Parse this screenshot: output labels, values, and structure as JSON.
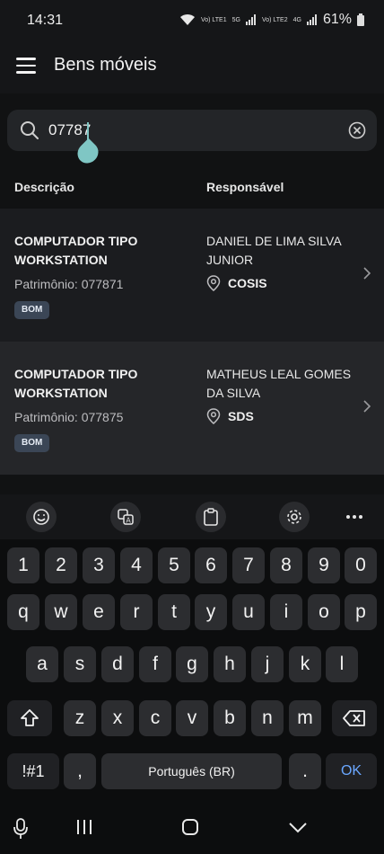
{
  "status": {
    "time": "14:31",
    "sim1": "Vo) LTE1",
    "sim2": "Vo) LTE2",
    "tag5g": "5G",
    "tag4g": "4G",
    "battery": "61%"
  },
  "app": {
    "title": "Bens móveis"
  },
  "search": {
    "value": "07787",
    "placeholder": ""
  },
  "table": {
    "headers": {
      "description": "Descrição",
      "responsible": "Responsável"
    },
    "rows": [
      {
        "description": "COMPUTADOR TIPO WORKSTATION",
        "patrimonio": "Patrimônio: 077871",
        "status": "BOM",
        "responsible": "DANIEL DE LIMA SILVA JUNIOR",
        "location": "COSIS"
      },
      {
        "description": "COMPUTADOR TIPO WORKSTATION",
        "patrimonio": "Patrimônio: 077875",
        "status": "BOM",
        "responsible": "MATHEUS LEAL GOMES DA SILVA",
        "location": "SDS"
      }
    ]
  },
  "keyboard": {
    "row_numbers": [
      "1",
      "2",
      "3",
      "4",
      "5",
      "6",
      "7",
      "8",
      "9",
      "0"
    ],
    "row1": [
      "q",
      "w",
      "e",
      "r",
      "t",
      "y",
      "u",
      "i",
      "o",
      "p"
    ],
    "row2": [
      "a",
      "s",
      "d",
      "f",
      "g",
      "h",
      "j",
      "k",
      "l"
    ],
    "row3": [
      "z",
      "x",
      "c",
      "v",
      "b",
      "n",
      "m"
    ],
    "symbols": "!#1",
    "comma": ",",
    "space": "Português (BR)",
    "period": ".",
    "ok": "OK"
  },
  "icons": {
    "menu": "menu-icon",
    "search": "search-icon",
    "clear": "clear-circle-icon",
    "location": "location-pin-icon",
    "chevron": "chevron-right-icon",
    "emoji": "emoji-icon",
    "translate": "translate-icon",
    "clipboard": "clipboard-icon",
    "settings": "gear-icon",
    "more": "more-dots-icon",
    "shift": "shift-icon",
    "backspace": "backspace-icon",
    "mic": "mic-icon",
    "recents": "recents-icon",
    "home": "home-icon",
    "back": "back-chevron-icon"
  },
  "colors": {
    "accent": "#7fc6c4",
    "badge": "#3b4656",
    "ok": "#6aa7ff"
  }
}
